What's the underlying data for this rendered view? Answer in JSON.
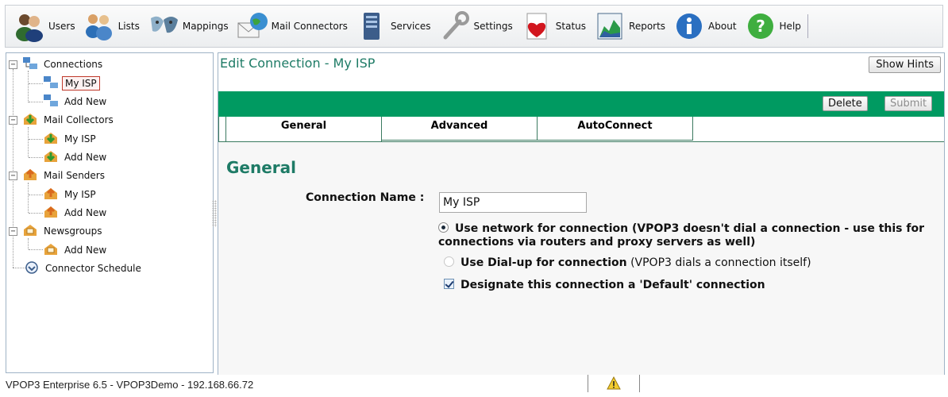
{
  "toolbar": {
    "items": [
      {
        "label": "Users",
        "icon": "users-icon"
      },
      {
        "label": "Lists",
        "icon": "lists-icon"
      },
      {
        "label": "Mappings",
        "icon": "mappings-icon"
      },
      {
        "label": "Mail Connectors",
        "icon": "mail-connectors-icon"
      },
      {
        "label": "Services",
        "icon": "services-icon"
      },
      {
        "label": "Settings",
        "icon": "settings-icon"
      },
      {
        "label": "Status",
        "icon": "status-icon"
      },
      {
        "label": "Reports",
        "icon": "reports-icon"
      },
      {
        "label": "About",
        "icon": "about-icon"
      },
      {
        "label": "Help",
        "icon": "help-icon"
      }
    ]
  },
  "tree": {
    "connections": {
      "label": "Connections",
      "children": [
        "My ISP",
        "Add New"
      ],
      "selected": "My ISP"
    },
    "mail_collectors": {
      "label": "Mail Collectors",
      "children": [
        "My ISP",
        "Add New"
      ]
    },
    "mail_senders": {
      "label": "Mail Senders",
      "children": [
        "My ISP",
        "Add New"
      ]
    },
    "newsgroups": {
      "label": "Newsgroups",
      "children": [
        "Add New"
      ]
    },
    "connector_schedule": {
      "label": "Connector Schedule"
    }
  },
  "panel": {
    "title": "Edit Connection - My ISP",
    "show_hints_label": "Show Hints",
    "delete_label": "Delete",
    "submit_label": "Submit",
    "tabs": [
      "General",
      "Advanced",
      "AutoConnect"
    ],
    "active_tab": "General",
    "section_title": "General",
    "connection_name_label": "Connection Name :",
    "connection_name_value": "My ISP",
    "option_network_bold": "Use network for connection (VPOP3 doesn't dial a connection - use this for connections via routers and proxy servers as well)",
    "option_dialup_bold": "Use Dial-up for connection",
    "option_dialup_note": "(VPOP3 dials a connection itself)",
    "option_default_bold": "Designate this connection a 'Default' connection",
    "network_selected": true,
    "default_checked": true
  },
  "status": {
    "text": "VPOP3 Enterprise 6.5 - VPOP3Demo - 192.168.66.72"
  },
  "colors": {
    "accent_green": "#009a61",
    "title_green": "#1e7b66"
  }
}
